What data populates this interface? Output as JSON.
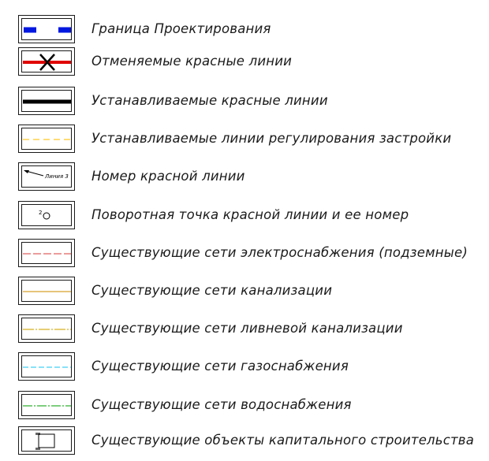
{
  "legend": {
    "items": [
      {
        "label": "Граница Проектирования",
        "symbol": "design-boundary-icon",
        "color": "#0018e0"
      },
      {
        "label": "Отменяемые красные линии",
        "symbol": "cancelled-red-line-icon",
        "color": "#e00000"
      },
      {
        "label": "Устанавливаемые красные линии",
        "symbol": "established-red-line-icon",
        "color": "#000000"
      },
      {
        "label": "Устанавливаемые линии регулирования застройки",
        "symbol": "building-regulation-line-icon",
        "color": "#ffd24a"
      },
      {
        "label": "Номер красной линии",
        "symbol": "red-line-number-icon",
        "sample_text": "Линия 3"
      },
      {
        "label": "Поворотная точка красной линии и ее номер",
        "symbol": "turning-point-icon",
        "sample_text": "2"
      },
      {
        "label": "Существующие сети электроснабжения (подземные)",
        "symbol": "power-network-icon",
        "color": "#e06060"
      },
      {
        "label": "Существующие сети канализации",
        "symbol": "sewer-network-icon",
        "color": "#d8a12a"
      },
      {
        "label": "Существующие сети ливневой канализации",
        "symbol": "storm-sewer-network-icon",
        "color": "#d8b020"
      },
      {
        "label": "Существующие сети газоснабжения",
        "symbol": "gas-network-icon",
        "color": "#40d0f0"
      },
      {
        "label": "Существующие сети водоснабжения",
        "symbol": "water-network-icon",
        "color": "#30b030"
      },
      {
        "label": "Существующие объекты капитального строительства",
        "symbol": "capital-building-icon"
      }
    ]
  }
}
